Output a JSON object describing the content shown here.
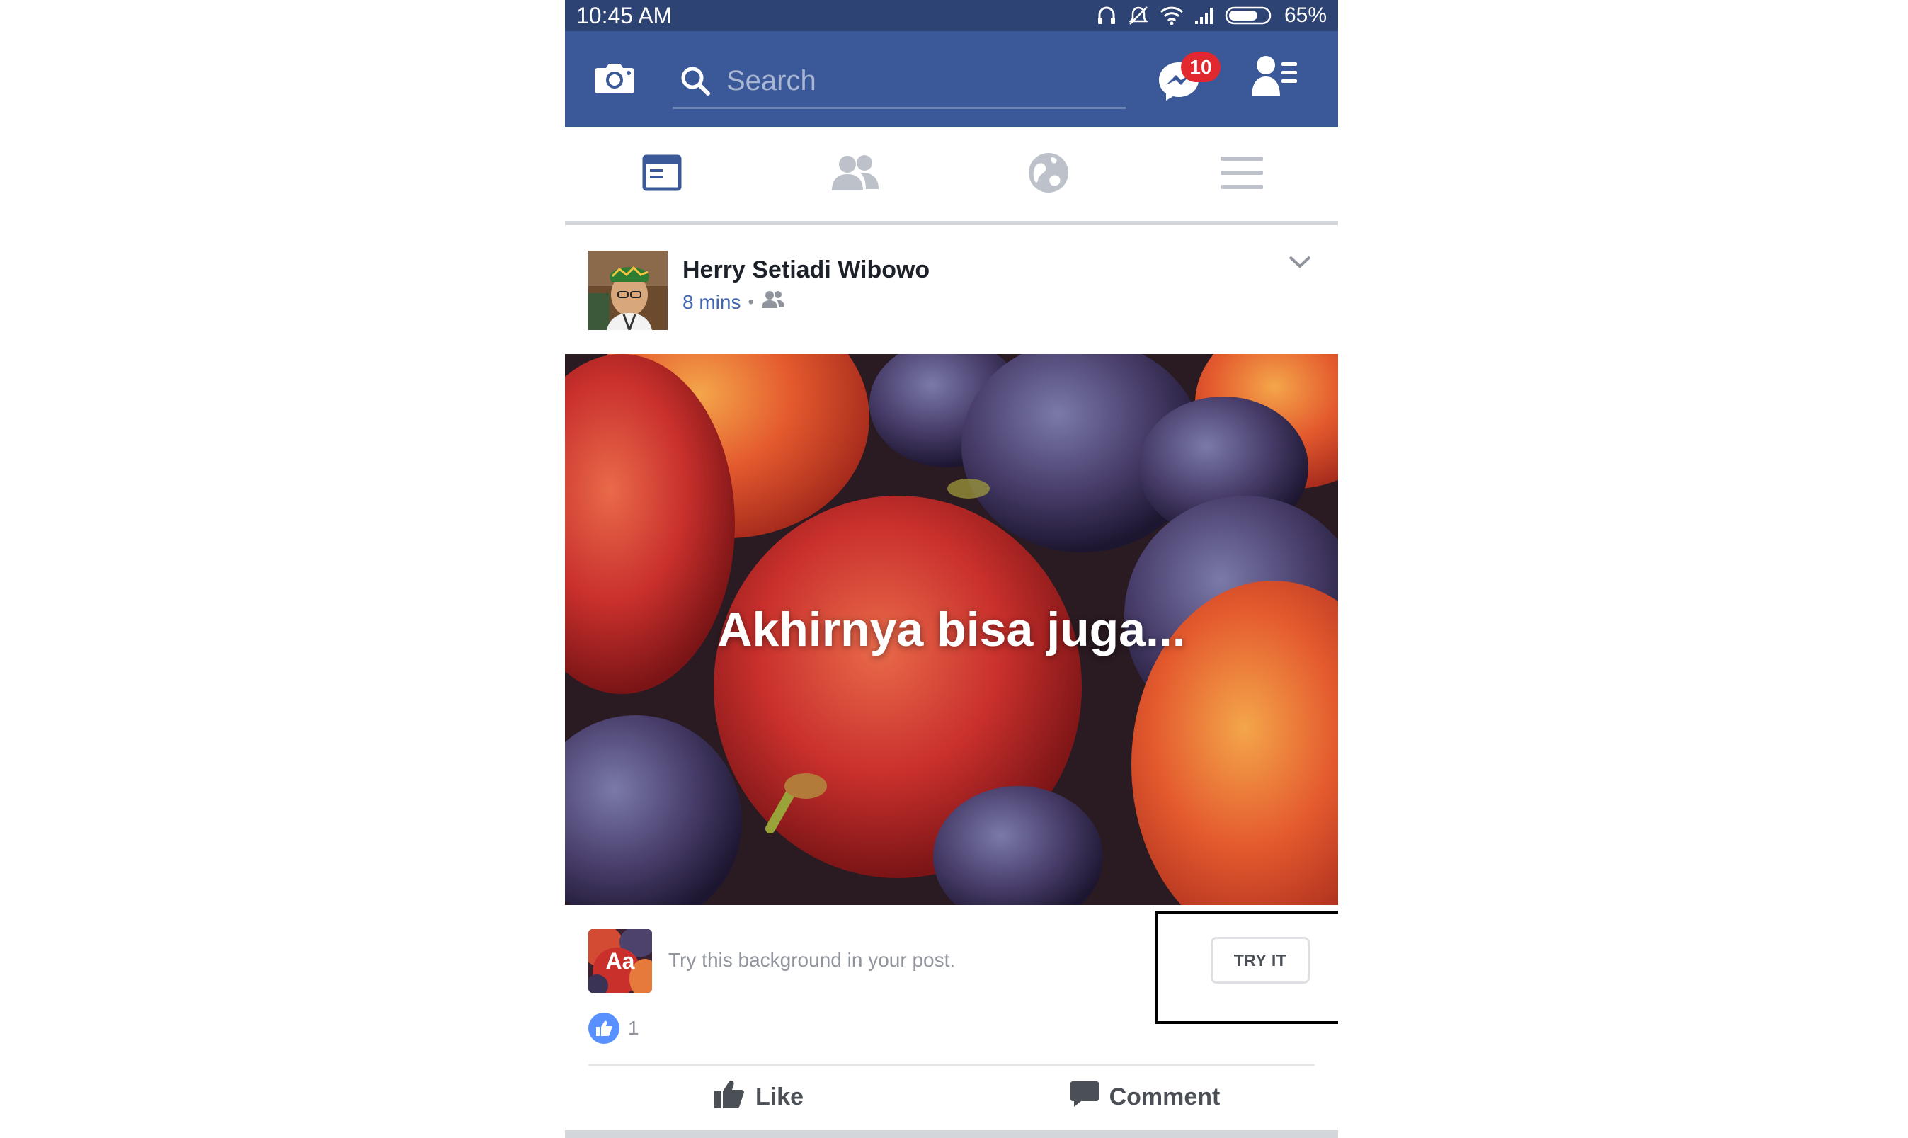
{
  "status_bar": {
    "time": "10:45 AM",
    "battery": "65%",
    "icons": [
      "headphones-icon",
      "silent-icon",
      "wifi-icon",
      "signal-icon",
      "battery-icon"
    ]
  },
  "header": {
    "search_placeholder": "Search",
    "messenger_badge": "10",
    "background_color": "#3b5998",
    "badge_color": "#e0282e"
  },
  "tabs": [
    {
      "name": "news-feed",
      "icon": "news-feed-icon",
      "active": true
    },
    {
      "name": "friends",
      "icon": "friends-icon",
      "active": false
    },
    {
      "name": "notifications",
      "icon": "globe-icon",
      "active": false
    },
    {
      "name": "menu",
      "icon": "hamburger-icon",
      "active": false
    }
  ],
  "post": {
    "author": "Herry Setiadi Wibowo",
    "time": "8 mins",
    "audience_icon": "friends-icon",
    "caption": "Akhirnya bisa juga...",
    "try_background": {
      "thumb_label": "Aa",
      "text": "Try this background in your post.",
      "button": "TRY IT"
    },
    "reactions": {
      "count": "1",
      "icon": "like-icon"
    },
    "actions": {
      "like": "Like",
      "comment": "Comment"
    }
  }
}
